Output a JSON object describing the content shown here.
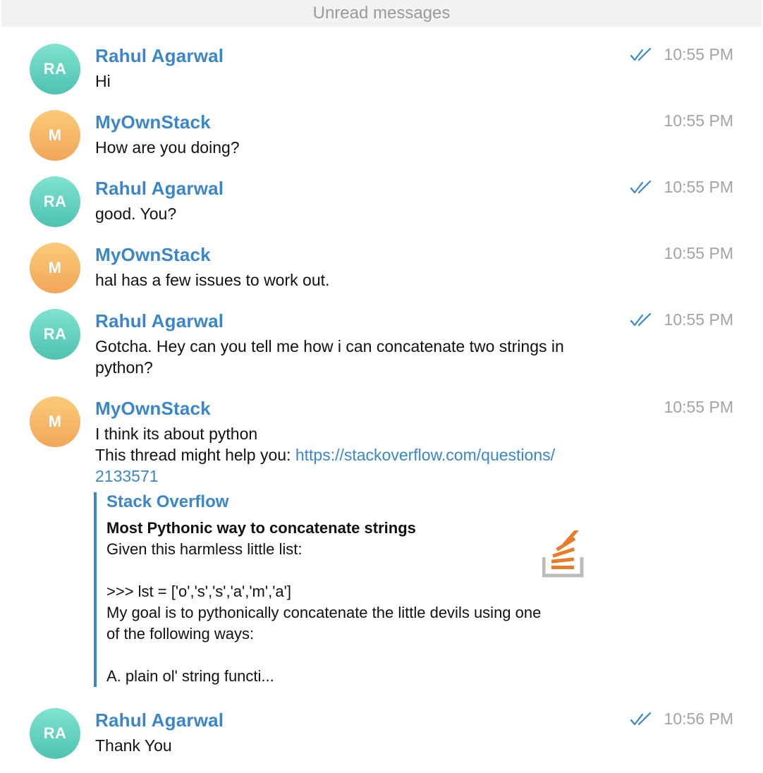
{
  "unread_bar": {
    "label": "Unread messages"
  },
  "colors": {
    "link": "#3b86c9",
    "teal_avatar": "#5dcfbd",
    "orange_avatar": "#f4b463",
    "timestamp": "#a3a3a7"
  },
  "messages": [
    {
      "sender": "Rahul Agarwal",
      "initials": "RA",
      "avatar_color": "teal",
      "time": "10:55 PM",
      "read_receipt": "double-check-icon",
      "lines": [
        "Hi"
      ]
    },
    {
      "sender": "MyOwnStack",
      "initials": "M",
      "avatar_color": "orange",
      "time": "10:55 PM",
      "lines": [
        "How are you doing?"
      ]
    },
    {
      "sender": "Rahul Agarwal",
      "initials": "RA",
      "avatar_color": "teal",
      "time": "10:55 PM",
      "read_receipt": "double-check-icon",
      "lines": [
        "good. You?"
      ]
    },
    {
      "sender": "MyOwnStack",
      "initials": "M",
      "avatar_color": "orange",
      "time": "10:55 PM",
      "lines": [
        "hal has a few issues to work out."
      ]
    },
    {
      "sender": "Rahul Agarwal",
      "initials": "RA",
      "avatar_color": "teal",
      "time": "10:55 PM",
      "read_receipt": "double-check-icon",
      "lines": [
        "Gotcha. Hey can you tell me how i can concatenate two strings in",
        "python?"
      ]
    },
    {
      "sender": "MyOwnStack",
      "initials": "M",
      "avatar_color": "orange",
      "time": "10:55 PM",
      "lines": [
        "I think its about python"
      ],
      "link_prefix": "This thread might help you: ",
      "link_part1": "https://stackoverflow.com/questions/",
      "link_part2": "2133571",
      "preview": {
        "site": "Stack Overflow",
        "title": "Most Pythonic way to concatenate strings",
        "description_lines": [
          "Given this harmless little list:",
          "",
          ">>> lst = ['o','s','s','a','m','a']",
          "My goal is to pythonically concatenate the little devils using one",
          "of the following ways:",
          "",
          "A. plain ol' string functi..."
        ],
        "logo": "stackoverflow-logo-icon"
      }
    },
    {
      "sender": "Rahul Agarwal",
      "initials": "RA",
      "avatar_color": "teal",
      "time": "10:56 PM",
      "read_receipt": "double-check-icon",
      "lines": [
        "Thank You"
      ]
    }
  ]
}
